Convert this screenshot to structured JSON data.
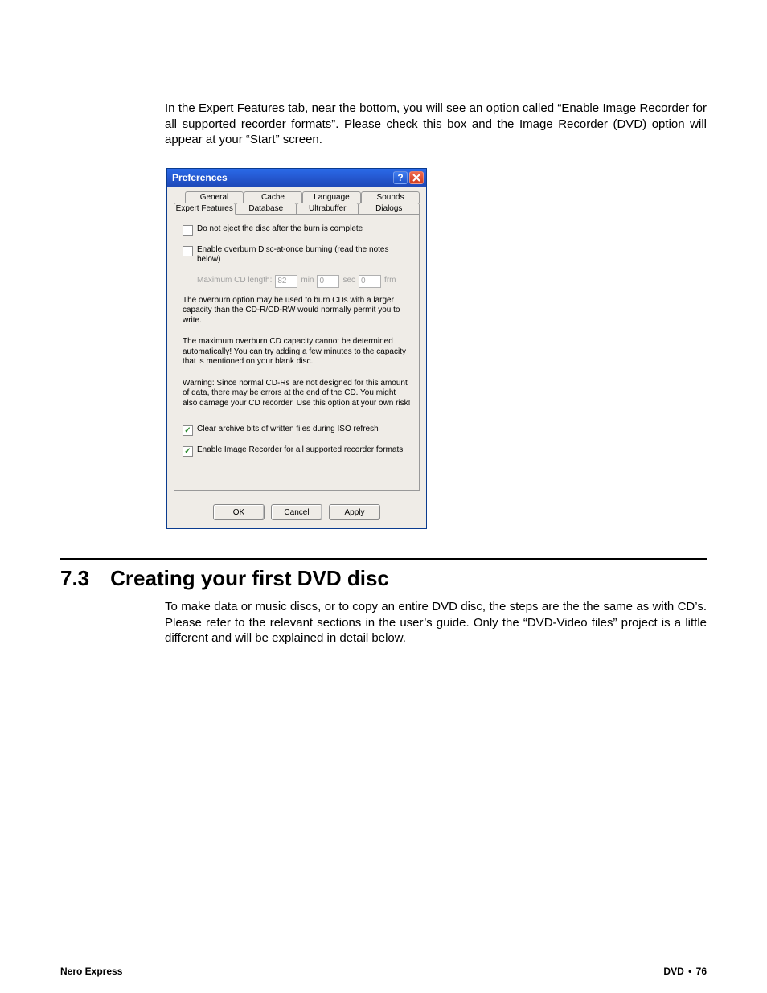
{
  "intro": "In the Expert Features tab, near the bottom, you will see an option called “Enable Image Recorder for all supported recorder formats”. Please check this box and the Image Recorder (DVD) option will appear at your “Start” screen.",
  "dialog": {
    "title": "Preferences",
    "tabs_row1": [
      "General",
      "Cache",
      "Language",
      "Sounds"
    ],
    "tabs_row2": [
      "Expert Features",
      "Database",
      "Ultrabuffer",
      "Dialogs"
    ],
    "active_tab": "Expert Features",
    "chk_eject": "Do not eject the disc after the burn is complete",
    "chk_overburn": "Enable overburn Disc-at-once burning (read the notes below)",
    "cdlen_label": "Maximum CD length:",
    "cdlen_min": "82",
    "cdlen_min_lbl": "min",
    "cdlen_sec": "0",
    "cdlen_sec_lbl": "sec",
    "cdlen_frm": "0",
    "cdlen_frm_lbl": "frm",
    "info1": "The overburn option may be used to burn CDs with a larger capacity than the CD-R/CD-RW would normally permit you to write.",
    "info2": "The maximum overburn CD capacity cannot be determined automatically! You can try adding a few minutes to the capacity that is mentioned on your blank disc.",
    "info3": "Warning: Since normal CD-Rs are not designed for this amount of data, there may be errors at the end of the CD. You might also damage your CD recorder. Use this option at your own risk!",
    "chk_archive": "Clear archive bits of written files during ISO refresh",
    "chk_imgrec": "Enable Image Recorder for all supported recorder formats",
    "btn_ok": "OK",
    "btn_cancel": "Cancel",
    "btn_apply": "Apply"
  },
  "section_heading": "7.3 Creating your first DVD disc",
  "section_body": "To make data or music discs, or to copy an entire DVD disc, the steps are the the same as with CD’s. Please refer to the relevant sections in the user’s guide. Only the “DVD-Video files” project is a little different and will be explained in detail below.",
  "footer": {
    "left": "Nero Express",
    "right_section": "DVD",
    "right_page": "76"
  }
}
